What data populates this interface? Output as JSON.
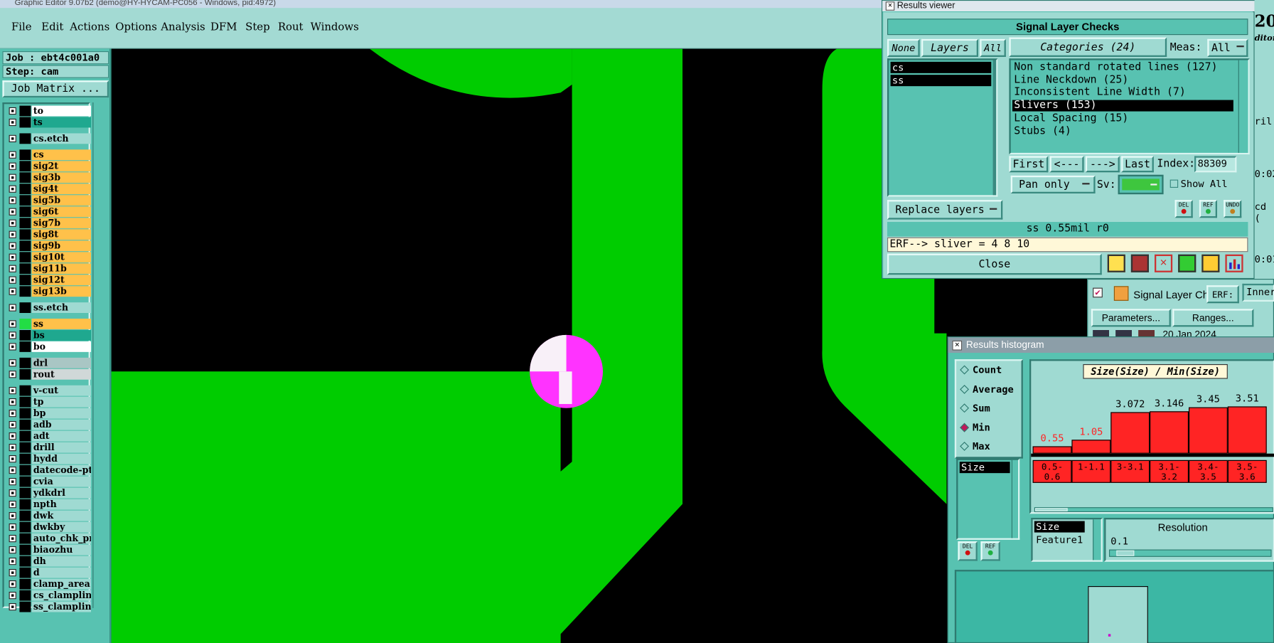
{
  "main_window": {
    "title": "Graphic Editor 9.07b2 (demo@HY-HYCAM-PC056 - Windows, pid:4972)",
    "menu": [
      {
        "label": "File"
      },
      {
        "label": "Edit"
      },
      {
        "label": "Actions"
      },
      {
        "label": "Options"
      },
      {
        "label": "Analysis"
      },
      {
        "label": "DFM"
      },
      {
        "label": "Step"
      },
      {
        "label": "Rout"
      },
      {
        "label": "Windows"
      }
    ]
  },
  "left_panel": {
    "job": "Job : ebt4c001a0",
    "step": "Step: cam",
    "job_matrix_button": "Job Matrix ...",
    "layers": [
      {
        "name": "to",
        "color": "#ffffff"
      },
      {
        "name": "ts",
        "color": "#1fa88f"
      },
      {
        "name": "cs.etch",
        "color": "#9fdad2"
      },
      {
        "name": "cs",
        "color": "#ffc14a"
      },
      {
        "name": "sig2t",
        "color": "#ffc14a"
      },
      {
        "name": "sig3b",
        "color": "#ffc14a"
      },
      {
        "name": "sig4t",
        "color": "#ffc14a"
      },
      {
        "name": "sig5b",
        "color": "#ffc14a"
      },
      {
        "name": "sig6t",
        "color": "#ffc14a"
      },
      {
        "name": "sig7b",
        "color": "#ffc14a"
      },
      {
        "name": "sig8t",
        "color": "#ffc14a"
      },
      {
        "name": "sig9b",
        "color": "#ffc14a"
      },
      {
        "name": "sig10t",
        "color": "#ffc14a"
      },
      {
        "name": "sig11b",
        "color": "#ffc14a"
      },
      {
        "name": "sig12t",
        "color": "#ffc14a"
      },
      {
        "name": "sig13b",
        "color": "#ffc14a"
      },
      {
        "name": "ss.etch",
        "color": "#9fdad2"
      },
      {
        "name": "ss",
        "color": "#ffc14a"
      },
      {
        "name": "bs",
        "color": "#1fa88f"
      },
      {
        "name": "bo",
        "color": "#ffffff"
      },
      {
        "name": "drl",
        "color": "#a9c6c4"
      },
      {
        "name": "rout",
        "color": "#d0d8d8"
      },
      {
        "name": "v-cut",
        "color": "#9fdad2"
      },
      {
        "name": "tp",
        "color": "#9fdad2"
      },
      {
        "name": "bp",
        "color": "#9fdad2"
      },
      {
        "name": "adb",
        "color": "#9fdad2"
      },
      {
        "name": "adt",
        "color": "#9fdad2"
      },
      {
        "name": "drill",
        "color": "#9fdad2"
      },
      {
        "name": "hydd",
        "color": "#9fdad2"
      },
      {
        "name": "datecode-pt",
        "color": "#9fdad2"
      },
      {
        "name": "cvia",
        "color": "#9fdad2"
      },
      {
        "name": "ydkdrl",
        "color": "#9fdad2"
      },
      {
        "name": "npth",
        "color": "#9fdad2"
      },
      {
        "name": "dwk",
        "color": "#9fdad2"
      },
      {
        "name": "dwkby",
        "color": "#9fdad2"
      },
      {
        "name": "auto_chk_pn",
        "color": "#9fdad2"
      },
      {
        "name": "biaozhu",
        "color": "#9fdad2"
      },
      {
        "name": "dh",
        "color": "#9fdad2"
      },
      {
        "name": "d",
        "color": "#9fdad2"
      },
      {
        "name": "clamp_area",
        "color": "#9fdad2"
      },
      {
        "name": "cs_clampline",
        "color": "#9fdad2"
      },
      {
        "name": "ss_clampline",
        "color": "#9fdad2"
      }
    ]
  },
  "results_viewer": {
    "title": "Results viewer",
    "header": "Signal Layer Checks",
    "none_btn": "None",
    "layers_btn": "Layers",
    "all_btn": "All",
    "layers": [
      "cs",
      "ss"
    ],
    "categories_btn": "Categories (24)",
    "meas_label": "Meas:",
    "meas_value": "All",
    "categories": [
      "Non standard rotated lines (127)",
      "Line Neckdown (25)",
      "Inconsistent Line Width (7)",
      "Slivers (153)",
      "Local Spacing (15)",
      "Stubs (4)"
    ],
    "selected_category_index": 3,
    "first_btn": "First",
    "prev_btn": "<---",
    "next_btn": "--->",
    "last_btn": "Last",
    "index_label": "Index:",
    "index_value": "88309",
    "pan_mode": "Pan only",
    "sv_label": "Sv:",
    "show_all_label": "Show All",
    "replace_layers": "Replace layers",
    "status_line": "ss 0.55mil  r0",
    "erf_line": "ERF--> sliver = 4 8 10",
    "close_btn": "Close",
    "mini_btns": [
      "DEL",
      "REF",
      "UNDO"
    ]
  },
  "background_window": {
    "task_label": "Signal Layer Ch",
    "erf_label": "ERF:",
    "erf_value": "Inner",
    "parameters_btn": "Parameters...",
    "ranges_btn": "Ranges...",
    "date": "20 Jan 2024",
    "right_fragments": [
      "20",
      "ditor",
      "ril",
      "0:02",
      "cd (",
      "0:01"
    ]
  },
  "results_histogram": {
    "title": "Results histogram",
    "modes": [
      "Count",
      "Average",
      "Sum",
      "Min",
      "Max"
    ],
    "selected_mode": "Min",
    "attr_list": [
      "Size"
    ],
    "chart_title": "Size(Size) / Min(Size)",
    "table_headers": [
      "Size",
      "Feature1"
    ],
    "resolution_label": "Resolution",
    "resolution_value": "0.1",
    "mini_btns": [
      "DEL",
      "REF"
    ],
    "chart_data": {
      "type": "bar",
      "title": "Size(Size) / Min(Size)",
      "categories": [
        "0.5-0.6",
        "1-1.1",
        "3-3.1",
        "3.1-3.2",
        "3.4-3.5",
        "3.5-3.6"
      ],
      "values": [
        0.55,
        1.05,
        3.072,
        3.146,
        3.45,
        3.51
      ],
      "value_labels": [
        "0.55",
        "1.05",
        "3.072",
        "3.146",
        "3.45",
        "3.51"
      ],
      "highlight_color": "#ff2424"
    }
  },
  "colors": {
    "panel": "#58c2b1",
    "copper": "#00cc00",
    "marker": "#ff33ff",
    "canvas": "#000000"
  }
}
